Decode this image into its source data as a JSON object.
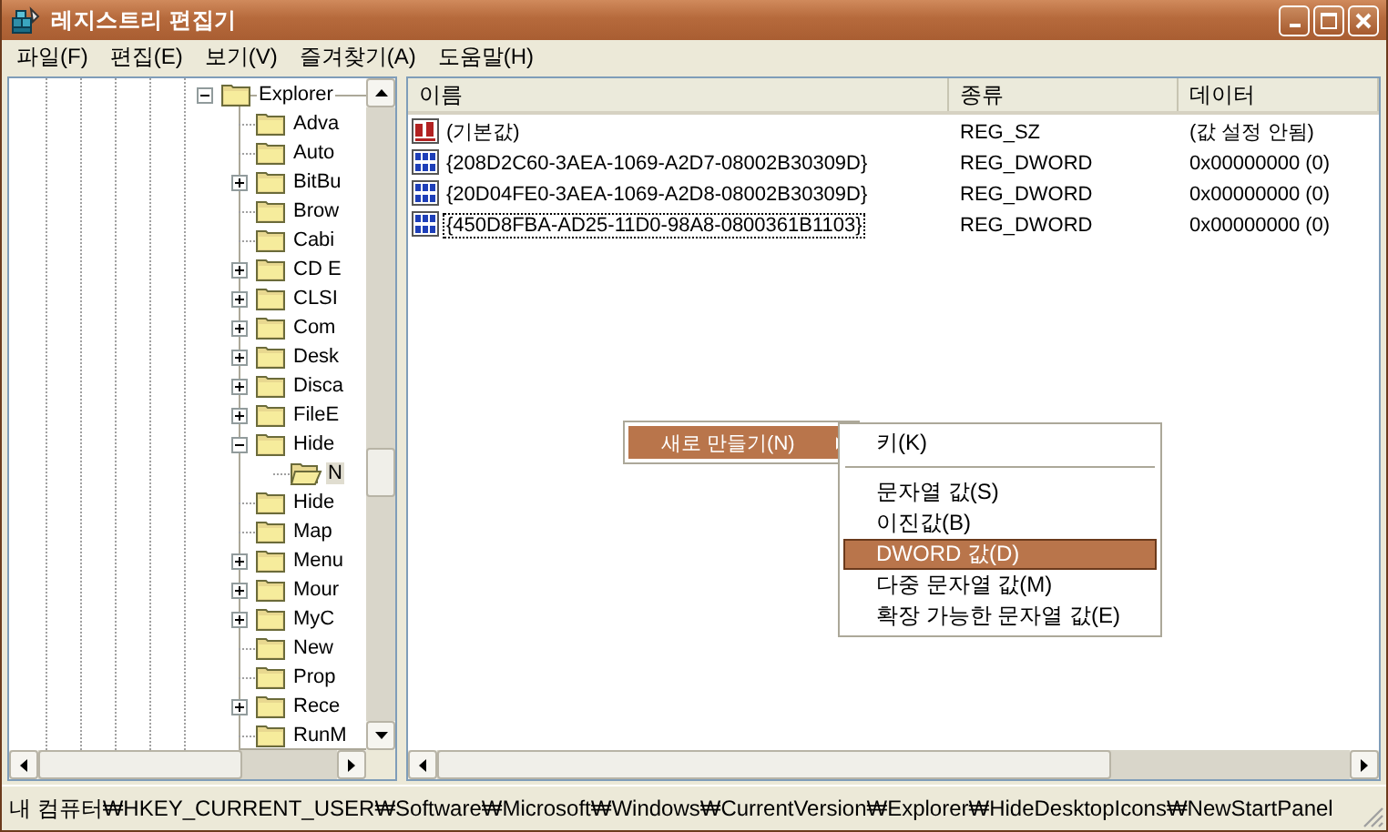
{
  "window": {
    "title": "레지스트리 편집기"
  },
  "menu": [
    "파일(F)",
    "편집(E)",
    "보기(V)",
    "즐겨찾기(A)",
    "도움말(H)"
  ],
  "tree": [
    {
      "label": "Explorer",
      "kind": "branch",
      "expanded": true,
      "selected": false,
      "children": [
        {
          "label": "Adva",
          "kind": "leaf",
          "selected": false
        },
        {
          "label": "Auto",
          "kind": "leaf",
          "selected": false
        },
        {
          "label": "BitBu",
          "kind": "branch",
          "expanded": false,
          "selected": false
        },
        {
          "label": "Brow",
          "kind": "leaf",
          "selected": false
        },
        {
          "label": "Cabi",
          "kind": "leaf",
          "selected": false
        },
        {
          "label": "CD E",
          "kind": "branch",
          "expanded": false,
          "selected": false
        },
        {
          "label": "CLSI",
          "kind": "branch",
          "expanded": false,
          "selected": false
        },
        {
          "label": "Com",
          "kind": "branch",
          "expanded": false,
          "selected": false
        },
        {
          "label": "Desk",
          "kind": "branch",
          "expanded": false,
          "selected": false
        },
        {
          "label": "Disca",
          "kind": "branch",
          "expanded": false,
          "selected": false
        },
        {
          "label": "FileE",
          "kind": "branch",
          "expanded": false,
          "selected": false
        },
        {
          "label": "Hide",
          "kind": "branch",
          "expanded": true,
          "selected": false,
          "children": [
            {
              "label": "N",
              "kind": "leaf",
              "selected": true
            }
          ]
        },
        {
          "label": "Hide",
          "kind": "leaf",
          "selected": false
        },
        {
          "label": "Map",
          "kind": "leaf",
          "selected": false
        },
        {
          "label": "Menu",
          "kind": "branch",
          "expanded": false,
          "selected": false
        },
        {
          "label": "Mour",
          "kind": "branch",
          "expanded": false,
          "selected": false
        },
        {
          "label": "MyC",
          "kind": "branch",
          "expanded": false,
          "selected": false
        },
        {
          "label": "New",
          "kind": "leaf",
          "selected": false
        },
        {
          "label": "Prop",
          "kind": "leaf",
          "selected": false
        },
        {
          "label": "Rece",
          "kind": "branch",
          "expanded": false,
          "selected": false
        },
        {
          "label": "RunM",
          "kind": "leaf",
          "selected": false
        }
      ]
    }
  ],
  "columns": [
    "이름",
    "종류",
    "데이터"
  ],
  "values": [
    {
      "kind": "string",
      "name": "(기본값)",
      "type": "REG_SZ",
      "data": "(값 설정 안됨)",
      "focused": false
    },
    {
      "kind": "dword",
      "name": "{208D2C60-3AEA-1069-A2D7-08002B30309D}",
      "type": "REG_DWORD",
      "data": "0x00000000 (0)",
      "focused": false
    },
    {
      "kind": "dword",
      "name": "{20D04FE0-3AEA-1069-A2D8-08002B30309D}",
      "type": "REG_DWORD",
      "data": "0x00000000 (0)",
      "focused": false
    },
    {
      "kind": "dword",
      "name": "{450D8FBA-AD25-11D0-98A8-0800361B1103}",
      "type": "REG_DWORD",
      "data": "0x00000000 (0)",
      "focused": true
    }
  ],
  "context_menu": {
    "items": [
      {
        "label": "새로 만들기(N)",
        "selected": true,
        "has_submenu": true
      }
    ]
  },
  "submenu": {
    "items": [
      {
        "kind": "item",
        "label": "키(K)",
        "selected": false
      },
      {
        "kind": "separator"
      },
      {
        "kind": "item",
        "label": "문자열 값(S)",
        "selected": false
      },
      {
        "kind": "item",
        "label": "이진값(B)",
        "selected": false
      },
      {
        "kind": "item",
        "label": "DWORD 값(D)",
        "selected": true
      },
      {
        "kind": "item",
        "label": "다중 문자열 값(M)",
        "selected": false
      },
      {
        "kind": "item",
        "label": "확장 가능한 문자열 값(E)",
        "selected": false
      }
    ]
  },
  "status_bar": "내 컴퓨터₩HKEY_CURRENT_USER₩Software₩Microsoft₩Windows₩CurrentVersion₩Explorer₩HideDesktopIcons₩NewStartPanel"
}
